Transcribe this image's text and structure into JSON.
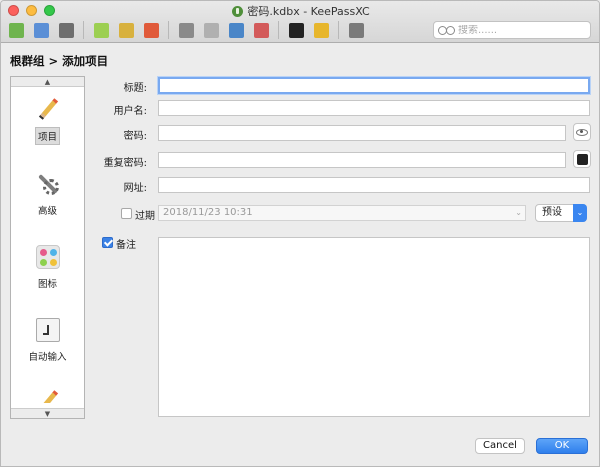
{
  "window": {
    "title": "密码.kdbx - KeePassXC"
  },
  "toolbar": {
    "items": [
      {
        "name": "new-database-icon",
        "color": "#6fb44e"
      },
      {
        "name": "open-database-icon",
        "color": "#5b8fd6"
      },
      {
        "name": "save-database-icon",
        "color": "#6e6e6e"
      },
      {
        "name": "add-entry-icon",
        "color": "#9ccf52"
      },
      {
        "name": "edit-entry-icon",
        "color": "#d8b13e"
      },
      {
        "name": "delete-entry-icon",
        "color": "#e05a3a"
      },
      {
        "name": "copy-username-icon",
        "color": "#8a8a8a"
      },
      {
        "name": "copy-password-icon",
        "color": "#b0b0b0"
      },
      {
        "name": "open-url-icon",
        "color": "#4a86c8"
      },
      {
        "name": "autotype-icon",
        "color": "#d35a5a"
      },
      {
        "name": "password-generator-icon",
        "color": "#222222"
      },
      {
        "name": "lock-database-icon",
        "color": "#e7b62c"
      },
      {
        "name": "settings-icon",
        "color": "#7a7a7a"
      }
    ]
  },
  "search": {
    "placeholder": "搜索......"
  },
  "breadcrumb": "根群组 > 添加项目",
  "sidebar": {
    "items": [
      {
        "label": "项目",
        "selected": true
      },
      {
        "label": "高级",
        "selected": false
      },
      {
        "label": "图标",
        "selected": false
      },
      {
        "label": "自动输入",
        "selected": false
      }
    ]
  },
  "form": {
    "title_label": "标题:",
    "title_value": "",
    "username_label": "用户名:",
    "username_value": "",
    "password_label": "密码:",
    "password_value": "",
    "repeat_label": "重复密码:",
    "repeat_value": "",
    "url_label": "网址:",
    "url_value": "",
    "expire_label": "过期",
    "expire_checked": false,
    "expire_date": "2018/11/23 10:31",
    "preset_label": "预设",
    "notes_label": "备注",
    "notes_checked": true,
    "notes_value": ""
  },
  "buttons": {
    "cancel": "Cancel",
    "ok": "OK"
  },
  "colors": {
    "accent": "#3a86f0",
    "focus_ring": "#79a9f0"
  }
}
